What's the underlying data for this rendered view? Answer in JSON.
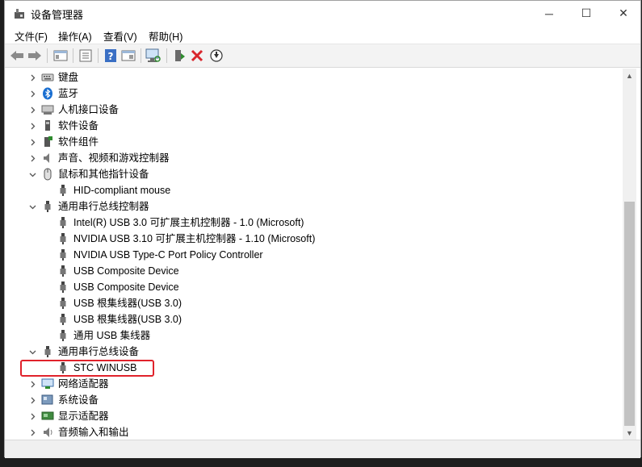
{
  "window": {
    "title": "设备管理器",
    "controls": {
      "minimize": "─",
      "maximize": "☐",
      "close": "✕"
    }
  },
  "menu": [
    "文件(F)",
    "操作(A)",
    "查看(V)",
    "帮助(H)"
  ],
  "toolbar": {
    "buttons": [
      "back-icon",
      "forward-icon",
      "show-hide-console-tree-icon",
      "properties-icon",
      "help-icon",
      "action-pane-icon",
      "scan-hardware-icon",
      "update-driver-icon",
      "uninstall-icon",
      "disable-device-icon"
    ]
  },
  "tree": {
    "items": [
      {
        "label": "键盘",
        "level": 0,
        "expanded": false,
        "icon": "keyboard-icon"
      },
      {
        "label": "蓝牙",
        "level": 0,
        "expanded": false,
        "icon": "bluetooth-icon"
      },
      {
        "label": "人机接口设备",
        "level": 0,
        "expanded": false,
        "icon": "hid-icon"
      },
      {
        "label": "软件设备",
        "level": 0,
        "expanded": false,
        "icon": "software-device-icon"
      },
      {
        "label": "软件组件",
        "level": 0,
        "expanded": false,
        "icon": "software-component-icon"
      },
      {
        "label": "声音、视频和游戏控制器",
        "level": 0,
        "expanded": false,
        "icon": "speaker-icon"
      },
      {
        "label": "鼠标和其他指针设备",
        "level": 0,
        "expanded": true,
        "icon": "mouse-icon"
      },
      {
        "label": "HID-compliant mouse",
        "level": 1,
        "icon": "usb-plug-icon"
      },
      {
        "label": "通用串行总线控制器",
        "level": 0,
        "expanded": true,
        "icon": "usb-plug-icon"
      },
      {
        "label": "Intel(R) USB 3.0 可扩展主机控制器 - 1.0 (Microsoft)",
        "level": 1,
        "icon": "usb-plug-icon"
      },
      {
        "label": "NVIDIA USB 3.10 可扩展主机控制器 - 1.10 (Microsoft)",
        "level": 1,
        "icon": "usb-plug-icon"
      },
      {
        "label": "NVIDIA USB Type-C Port Policy Controller",
        "level": 1,
        "icon": "usb-plug-icon"
      },
      {
        "label": "USB Composite Device",
        "level": 1,
        "icon": "usb-plug-icon"
      },
      {
        "label": "USB Composite Device",
        "level": 1,
        "icon": "usb-plug-icon"
      },
      {
        "label": "USB 根集线器(USB 3.0)",
        "level": 1,
        "icon": "usb-plug-icon"
      },
      {
        "label": "USB 根集线器(USB 3.0)",
        "level": 1,
        "icon": "usb-plug-icon"
      },
      {
        "label": "通用 USB 集线器",
        "level": 1,
        "icon": "usb-plug-icon"
      },
      {
        "label": "通用串行总线设备",
        "level": 0,
        "expanded": true,
        "icon": "usb-plug-icon"
      },
      {
        "label": "STC WINUSB",
        "level": 1,
        "icon": "usb-plug-icon",
        "highlighted": true
      },
      {
        "label": "网络适配器",
        "level": 0,
        "expanded": false,
        "icon": "network-adapter-icon"
      },
      {
        "label": "系统设备",
        "level": 0,
        "expanded": false,
        "icon": "system-device-icon"
      },
      {
        "label": "显示适配器",
        "level": 0,
        "expanded": false,
        "icon": "display-adapter-icon"
      },
      {
        "label": "音频输入和输出",
        "level": 0,
        "expanded": false,
        "icon": "audio-io-icon"
      }
    ]
  },
  "colors": {
    "highlight_border": "#e0222b",
    "scan_green": "#2e8b2e",
    "uninstall_red": "#d9262c",
    "help_blue": "#3a6fc4"
  }
}
